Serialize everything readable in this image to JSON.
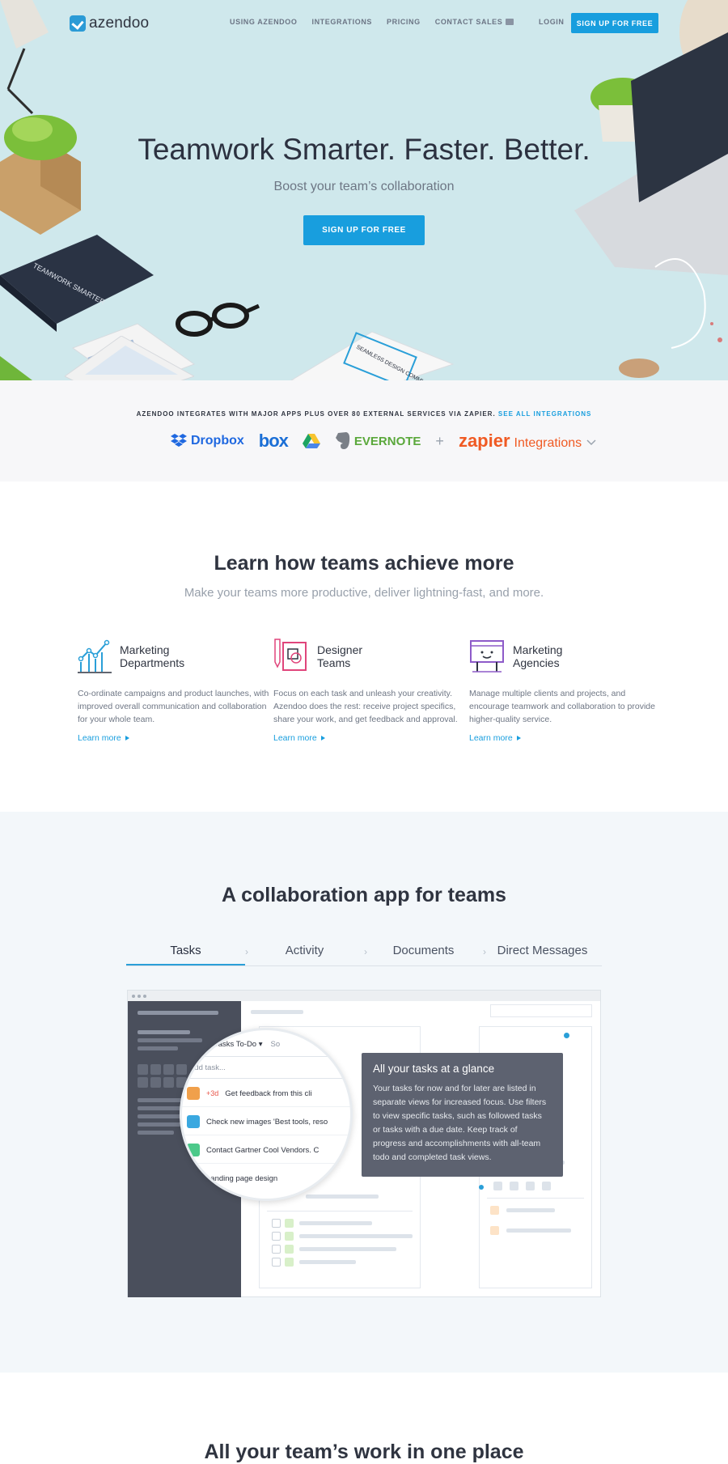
{
  "nav": {
    "logo": "azendoo",
    "links": [
      "USING AZENDOO",
      "INTEGRATIONS",
      "PRICING",
      "CONTACT SALES"
    ],
    "login": "LOGIN",
    "signup": "SIGN UP FOR FREE"
  },
  "hero": {
    "title": "Teamwork Smarter. Faster. Better.",
    "subtitle": "Boost your team’s collaboration",
    "cta": "SIGN UP FOR FREE",
    "notebook_text": "TEAMWORK SMARTER",
    "book_text": "SEAMLESS DESIGN COMMUNICATION"
  },
  "integrations": {
    "text": "AZENDOO INTEGRATES WITH MAJOR APPS PLUS OVER 80 EXTERNAL SERVICES VIA ZAPIER.",
    "link": "SEE ALL INTEGRATIONS",
    "logos": {
      "dropbox": "Dropbox",
      "box": "box",
      "evernote": "EVERNOTE",
      "plus": "+",
      "zapier": "zapier",
      "zapier_suffix": "Integrations"
    }
  },
  "learn": {
    "title": "Learn how teams achieve more",
    "subtitle": "Make your teams more productive, deliver lightning-fast, and more.",
    "teams": [
      {
        "name": "Marketing\nDepartments",
        "desc": "Co-ordinate campaigns and product launches, with improved overall communication and collaboration for your whole team.",
        "link": "Learn more",
        "icon": "chart-icon"
      },
      {
        "name": "Designer\nTeams",
        "desc": "Focus on each task and unleash your creativity. Azendoo does the rest: receive project specifics, share your work, and get feedback and approval.",
        "link": "Learn more",
        "icon": "design-icon"
      },
      {
        "name": "Marketing\nAgencies",
        "desc": "Manage multiple clients and projects, and encourage teamwork and collaboration to provide higher-quality service.",
        "link": "Learn more",
        "icon": "billboard-icon"
      }
    ]
  },
  "collab": {
    "title": "A collaboration app for teams",
    "tabs": [
      "Tasks",
      "Activity",
      "Documents",
      "Direct Messages"
    ],
    "lens": {
      "header": "Tasks To-Do",
      "header2": "So",
      "input_placeholder": "Add task...",
      "tasks": [
        {
          "text": "Get feedback from this cli",
          "flag": "+3d",
          "color": "#f0a04b"
        },
        {
          "text": "Check new images 'Best tools, reso",
          "color": "#3aa8e0"
        },
        {
          "text": "Contact Gartner Cool Vendors. C",
          "color": "#4cc98a"
        },
        {
          "text": "Landing page design",
          "color": "#e8564a"
        }
      ]
    },
    "tooltip": {
      "title": "All your tasks at a glance",
      "body": "Your tasks for now and for later are listed in separate views for increased focus. Use filters to view specific tasks, such as followed tasks or tasks with a due date. Keep track of progress and accomplishments with all-team todo and completed task views."
    }
  },
  "bottom": {
    "title": "All your team’s work in one place"
  },
  "colors": {
    "accent": "#189ede",
    "hero_bg": "#cfe8ec",
    "sidebar": "#4a4f5c"
  }
}
